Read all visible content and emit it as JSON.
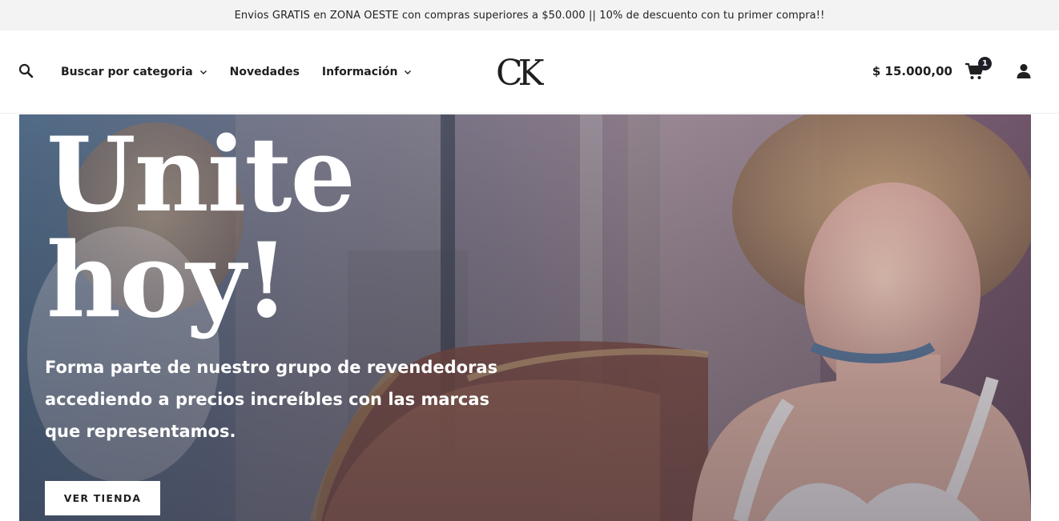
{
  "announcement": "Envios GRATIS en ZONA OESTE con compras superiores a $50.000 || 10% de descuento con tu primer compra!!",
  "header": {
    "search_icon": "search-icon",
    "nav": [
      {
        "label": "Buscar por categoria",
        "has_dropdown": true
      },
      {
        "label": "Novedades",
        "has_dropdown": false
      },
      {
        "label": "Información",
        "has_dropdown": true
      }
    ],
    "logo_text": "CK",
    "cart_total": "$ 15.000,00",
    "cart_count": "1",
    "cart_icon": "shopping-cart-icon",
    "account_icon": "user-icon"
  },
  "hero": {
    "title_line1": "Unite",
    "title_line2": "hoy!",
    "subtitle": "Forma parte de nuestro grupo de revendedoras accediendo a precios increíbles con las marcas que representamos.",
    "button_label": "VER TIENDA"
  },
  "colors": {
    "announcement_bg": "#f3f3f3",
    "header_bg": "#ffffff",
    "badge_bg": "#1f1f28",
    "hero_text": "#ffffff",
    "button_bg": "#ffffff"
  }
}
